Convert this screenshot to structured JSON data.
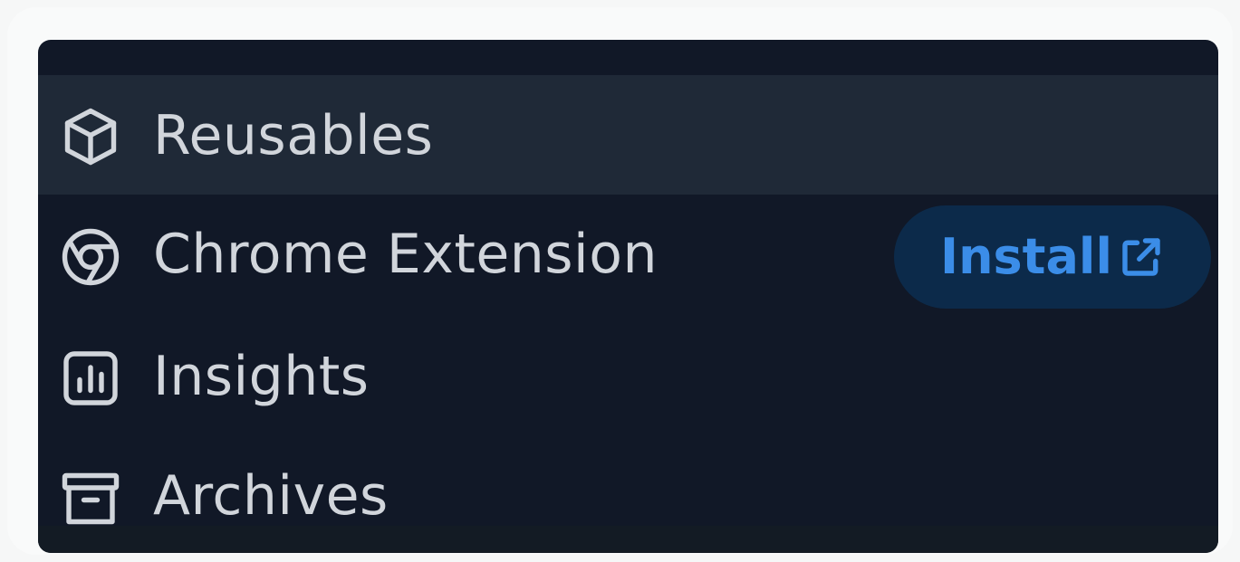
{
  "nav": {
    "items": [
      {
        "label": "Reusables",
        "icon": "cube-icon",
        "active": true
      },
      {
        "label": "Chrome Extension",
        "icon": "chrome-icon",
        "active": false
      },
      {
        "label": "Insights",
        "icon": "bar-chart-icon",
        "active": false
      },
      {
        "label": "Archives",
        "icon": "archive-box-icon",
        "active": false
      }
    ],
    "install_button": {
      "label": "Install",
      "icon": "external-link-icon"
    }
  },
  "colors": {
    "panel_background": "#111827",
    "active_item_background": "#1f2937",
    "text": "#d1d5db",
    "install_background": "#0c2a4a",
    "install_accent": "#3b8de8"
  }
}
